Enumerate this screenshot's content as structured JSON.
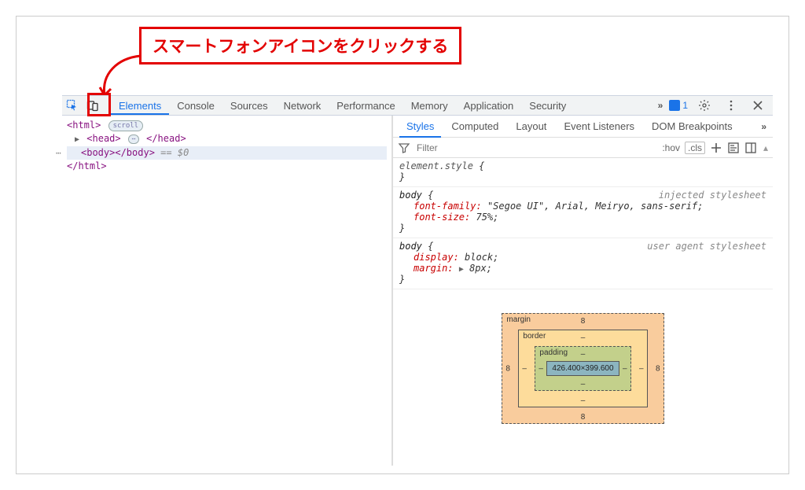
{
  "annotation": {
    "callout_text": "スマートフォンアイコンをクリックする"
  },
  "toolbar": {
    "tabs": [
      "Elements",
      "Console",
      "Sources",
      "Network",
      "Performance",
      "Memory",
      "Application",
      "Security"
    ],
    "active_tab": "Elements",
    "more_chevrons": "»",
    "issues_count": "1"
  },
  "dom": {
    "l1_open": "<html>",
    "l1_scroll": "scroll",
    "l2_head_open": "<head>",
    "l2_head_close": "</head>",
    "l3_body_open": "<body>",
    "l3_body_close": "</body>",
    "l3_eq": "== $0",
    "l4_close": "</html>",
    "ellipsis_glyph": "⋯"
  },
  "styles": {
    "subtabs": [
      "Styles",
      "Computed",
      "Layout",
      "Event Listeners",
      "DOM Breakpoints"
    ],
    "active_subtab": "Styles",
    "more_chevrons": "»",
    "filter_placeholder": "Filter",
    "hov": ":hov",
    "cls": ".cls",
    "rule1": {
      "selector": "element.style",
      "open": " {",
      "close": "}"
    },
    "rule2": {
      "selector": "body",
      "open": " {",
      "src": "injected stylesheet",
      "p1n": "font-family",
      "p1v": "\"Segoe UI\", Arial, Meiryo, sans-serif;",
      "p2n": "font-size",
      "p2v": "75%;",
      "close": "}"
    },
    "rule3": {
      "selector": "body",
      "open": " {",
      "src": "user agent stylesheet",
      "p1n": "display",
      "p1v": "block;",
      "p2n": "margin",
      "p2v": "8px;",
      "close": "}"
    }
  },
  "boxmodel": {
    "margin_label": "margin",
    "margin_t": "8",
    "margin_r": "8",
    "margin_b": "8",
    "margin_l": "8",
    "border_label": "border",
    "border_t": "–",
    "border_r": "–",
    "border_b": "–",
    "border_l": "–",
    "padding_label": "padding",
    "padding_t": "–",
    "padding_r": "–",
    "padding_b": "–",
    "padding_l": "–",
    "content": "426.400×399.600"
  }
}
